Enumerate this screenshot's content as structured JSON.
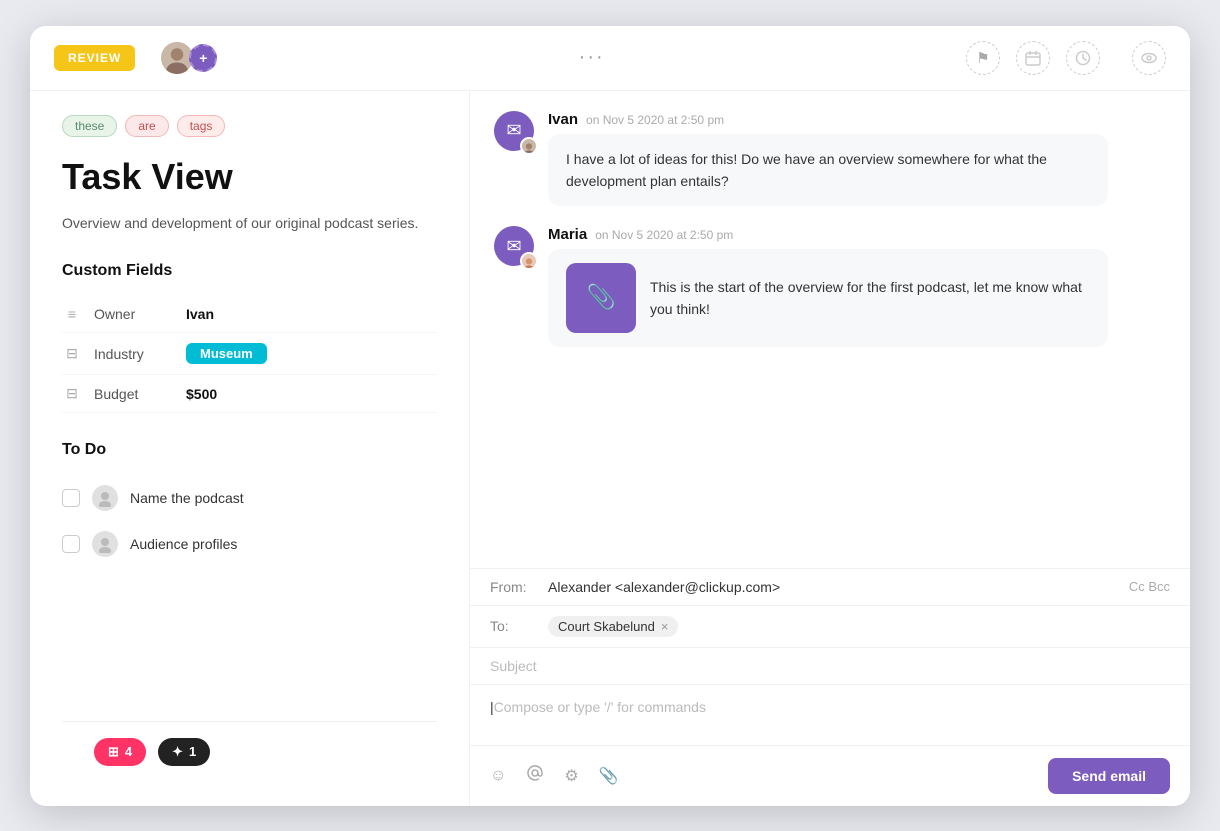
{
  "header": {
    "review_label": "REVIEW",
    "more_dots": "···",
    "flag_icon": "⚑",
    "calendar_icon": "▦",
    "clock_icon": "⏱",
    "eye_icon": "◉"
  },
  "tags": [
    {
      "label": "these",
      "class": "tag-these"
    },
    {
      "label": "are",
      "class": "tag-are"
    },
    {
      "label": "tags",
      "class": "tag-tags"
    }
  ],
  "task": {
    "title": "Task View",
    "description": "Overview and development of our original podcast series."
  },
  "custom_fields": {
    "section_title": "Custom Fields",
    "fields": [
      {
        "icon": "≡",
        "label": "Owner",
        "value": "Ivan",
        "type": "text"
      },
      {
        "icon": "⊟",
        "label": "Industry",
        "value": "Museum",
        "type": "badge"
      },
      {
        "icon": "⊟",
        "label": "Budget",
        "value": "$500",
        "type": "text"
      }
    ]
  },
  "todo": {
    "section_title": "To Do",
    "items": [
      {
        "label": "Name the podcast"
      },
      {
        "label": "Audience profiles"
      }
    ]
  },
  "counters": [
    {
      "icon": "⊞",
      "count": "4",
      "class": "badge-pink"
    },
    {
      "icon": "✦",
      "count": "1",
      "class": "badge-dark"
    }
  ],
  "messages": [
    {
      "name": "Ivan",
      "time": "on Nov 5 2020 at 2:50 pm",
      "text": "I have a lot of ideas for this! Do we have an overview somewhere for what the development plan entails?",
      "has_attachment": false,
      "avatar_color": "#7c5cbf"
    },
    {
      "name": "Maria",
      "time": "on Nov 5 2020 at 2:50 pm",
      "text": "This is the start of the overview for the first podcast, let me know what you think!",
      "has_attachment": true,
      "avatar_color": "#7c5cbf"
    }
  ],
  "email": {
    "from_label": "From:",
    "from_value": "Alexander <alexander@clickup.com>",
    "to_label": "To:",
    "to_recipient": "Court Skabelund",
    "cc_bcc": "Cc  Bcc",
    "subject_placeholder": "Subject",
    "compose_placeholder": "Compose or type '/' for commands",
    "send_label": "Send email"
  }
}
